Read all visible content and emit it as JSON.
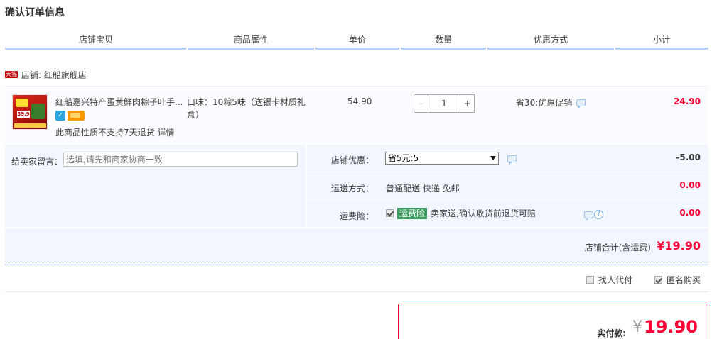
{
  "page_title": "确认订单信息",
  "columns": [
    "店铺宝贝",
    "商品属性",
    "单价",
    "数量",
    "优惠方式",
    "小计"
  ],
  "shop": {
    "badge": "天猫",
    "label": "店铺: 红船旗舰店"
  },
  "item": {
    "name": "红船嘉兴特产蛋黄鲜肉粽子叶手...",
    "attribute": "口味：10粽5味（送银卡材质礼盒）",
    "price": "54.90",
    "quantity": "1",
    "minus": "-",
    "plus": "+",
    "promo": "省30:优惠促销",
    "subtotal": "24.90",
    "no_return": "此商品性质不支持7天退货",
    "detail_link": "详情",
    "thumb_label": "39.9"
  },
  "message": {
    "label": "给卖家留言：",
    "placeholder": "选填,请先和商家协商一致"
  },
  "options": {
    "discount_label": "店铺优惠：",
    "discount_value": "省5元:5",
    "discount_amount": "-5.00",
    "shipping_label": "运送方式：",
    "shipping_value": "普通配送 快递 免邮",
    "shipping_amount": "0.00",
    "insurance_label": "运费险：",
    "insurance_tag": "运费险",
    "insurance_text": "卖家送,确认收货前退货可赔",
    "insurance_amount": "0.00",
    "insurance_checked": true,
    "help_icon_text": "?"
  },
  "shop_total": {
    "label": "店铺合计(含运费)",
    "amount": "¥19.90"
  },
  "extras": {
    "proxy_label": "找人代付",
    "proxy_checked": false,
    "anonymous_label": "匿名购买",
    "anonymous_checked": true
  },
  "payment": {
    "label": "实付款:",
    "currency": "¥",
    "amount": "19.90"
  },
  "colors": {
    "price_red": "#ff0036",
    "header_bar": "#b2d1ff",
    "panel_bg": "#f2f7ff",
    "insurance_green": "#3a9b5e"
  }
}
